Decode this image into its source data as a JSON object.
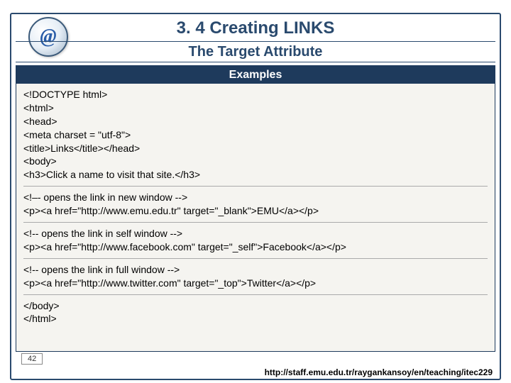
{
  "title": "3. 4 Creating LINKS",
  "subtitle": "The Target Attribute",
  "examples_label": "Examples",
  "logo_glyph": "@",
  "code": {
    "block1": {
      "l1": "<!DOCTYPE html>",
      "l2": "<html>",
      "l3": "<head>",
      "l4": "<meta charset = \"utf-8\">",
      "l5": "<title>Links</title></head>",
      "l6": "<body>",
      "l7": "<h3>Click a name to visit that site.</h3>"
    },
    "block2": {
      "c": "<!–- opens the link in new window -->",
      "p": "<p><a href=\"http://www.emu.edu.tr\" target=\"_blank\">EMU</a></p>"
    },
    "block3": {
      "c": "<!-- opens the link in self window -->",
      "p": "<p><a href=\"http://www.facebook.com\" target=\"_self\">Facebook</a></p>"
    },
    "block4": {
      "c": "<!-- opens the link in full window -->",
      "p": "<p><a href=\"http://www.twitter.com\" target=\"_top\">Twitter</a></p>"
    },
    "block5": {
      "l1": "</body>",
      "l2": "</html>"
    }
  },
  "page_number": "42",
  "footer_url": "http://staff.emu.edu.tr/raygankansoy/en/teaching/itec229"
}
